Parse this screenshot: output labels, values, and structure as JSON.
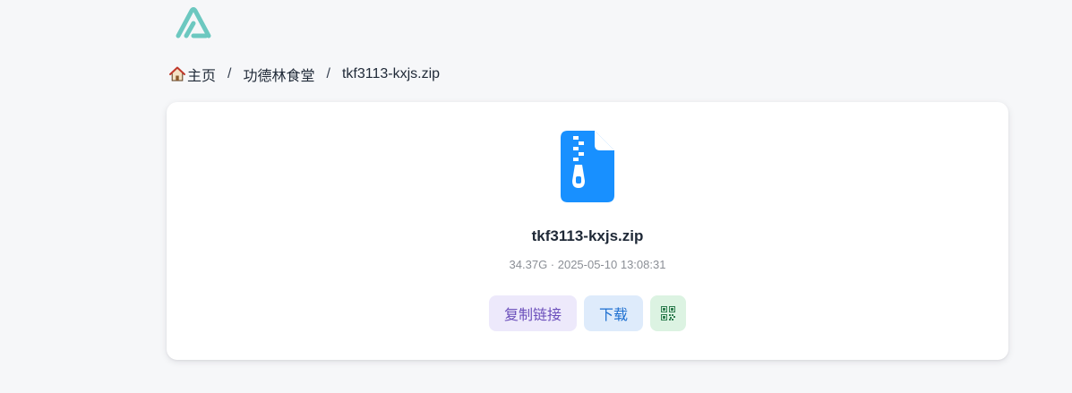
{
  "logo": {
    "icon": "logo-icon",
    "color": "#6cc8c0"
  },
  "breadcrumb": {
    "items": [
      {
        "label": "主页",
        "icon": "home-icon"
      },
      {
        "label": "功德林食堂"
      },
      {
        "label": "tkf3113-kxjs.zip"
      }
    ],
    "separator": "/"
  },
  "file": {
    "icon": "zip-file-icon",
    "icon_color": "#1890ff",
    "name": "tkf3113-kxjs.zip",
    "meta": "34.37G · 2025-05-10 13:08:31"
  },
  "actions": {
    "copy_link_label": "复制链接",
    "download_label": "下载",
    "qr_icon": "qr-code-icon"
  }
}
